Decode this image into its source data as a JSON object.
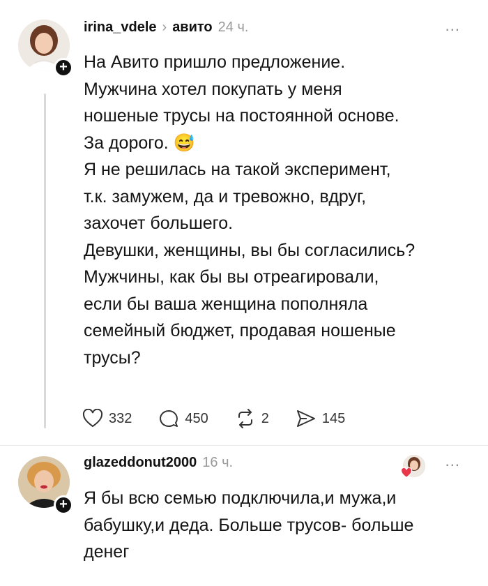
{
  "post1": {
    "username": "irina_vdele",
    "community": "авито",
    "time": "24 ч.",
    "more": "...",
    "lines": [
      "На Авито пришло предложение.",
      "Мужчина хотел покупать у меня",
      "ношеные трусы на постоянной основе.",
      "За дорого.",
      "Я не решилась на такой эксперимент,",
      "т.к. замужем, да и тревожно, вдруг,",
      "захочет большего.",
      "Девушки, женщины, вы бы согласились?",
      "Мужчины, как бы вы отреагировали,",
      "если бы ваша женщина пополняла",
      "семейный бюджет, продавая ношеные",
      "трусы?"
    ],
    "emoji": "😅",
    "stats": {
      "likes": "332",
      "comments": "450",
      "reposts": "2",
      "shares": "145"
    }
  },
  "post2": {
    "username": "glazeddonut2000",
    "time": "16 ч.",
    "more": "...",
    "lines": [
      "Я бы всю семью подключила,и мужа,и",
      "бабушку,и деда. Больше трусов- больше",
      "денег"
    ]
  },
  "icons": {
    "like": "heart-outline-icon",
    "comment": "comment-bubble-icon",
    "repost": "repost-arrows-icon",
    "share": "send-icon",
    "follow": "plus-icon",
    "liked_by_author": "heart-filled-icon"
  },
  "colors": {
    "accent_heart": "#e8374a",
    "text": "#141414",
    "muted": "#9a9a9a"
  }
}
